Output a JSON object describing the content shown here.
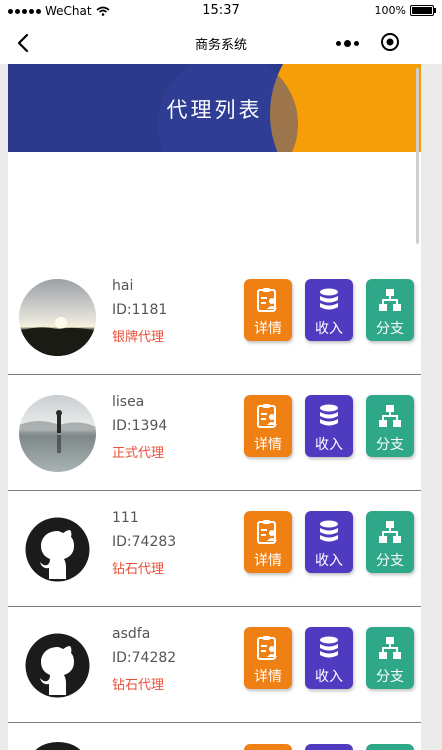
{
  "status_bar": {
    "carrier": "WeChat",
    "time": "15:37",
    "battery": "100%",
    "battery_level": 1.0
  },
  "nav": {
    "title": "商务系统"
  },
  "banner": {
    "title": "代理列表"
  },
  "agents": [
    {
      "name": "hai",
      "id_text": "ID:1181",
      "level": "银牌代理",
      "avatar": "sunset-photo"
    },
    {
      "name": "lisea",
      "id_text": "ID:1394",
      "level": "正式代理",
      "avatar": "lake-photo"
    },
    {
      "name": "111",
      "id_text": "ID:74283",
      "level": "钻石代理",
      "avatar": "github-icon"
    },
    {
      "name": "asdfa",
      "id_text": "ID:74282",
      "level": "钻石代理",
      "avatar": "github-icon"
    }
  ],
  "actions": {
    "detail_label": "详情",
    "income_label": "收入",
    "branch_label": "分支"
  },
  "colors": {
    "detail": "#ef8014",
    "income": "#4f3bc0",
    "branch": "#2fa88a",
    "level_text": "#e8503a",
    "banner_bg": "#2d3a8c",
    "banner_accent": "#f59e08"
  }
}
